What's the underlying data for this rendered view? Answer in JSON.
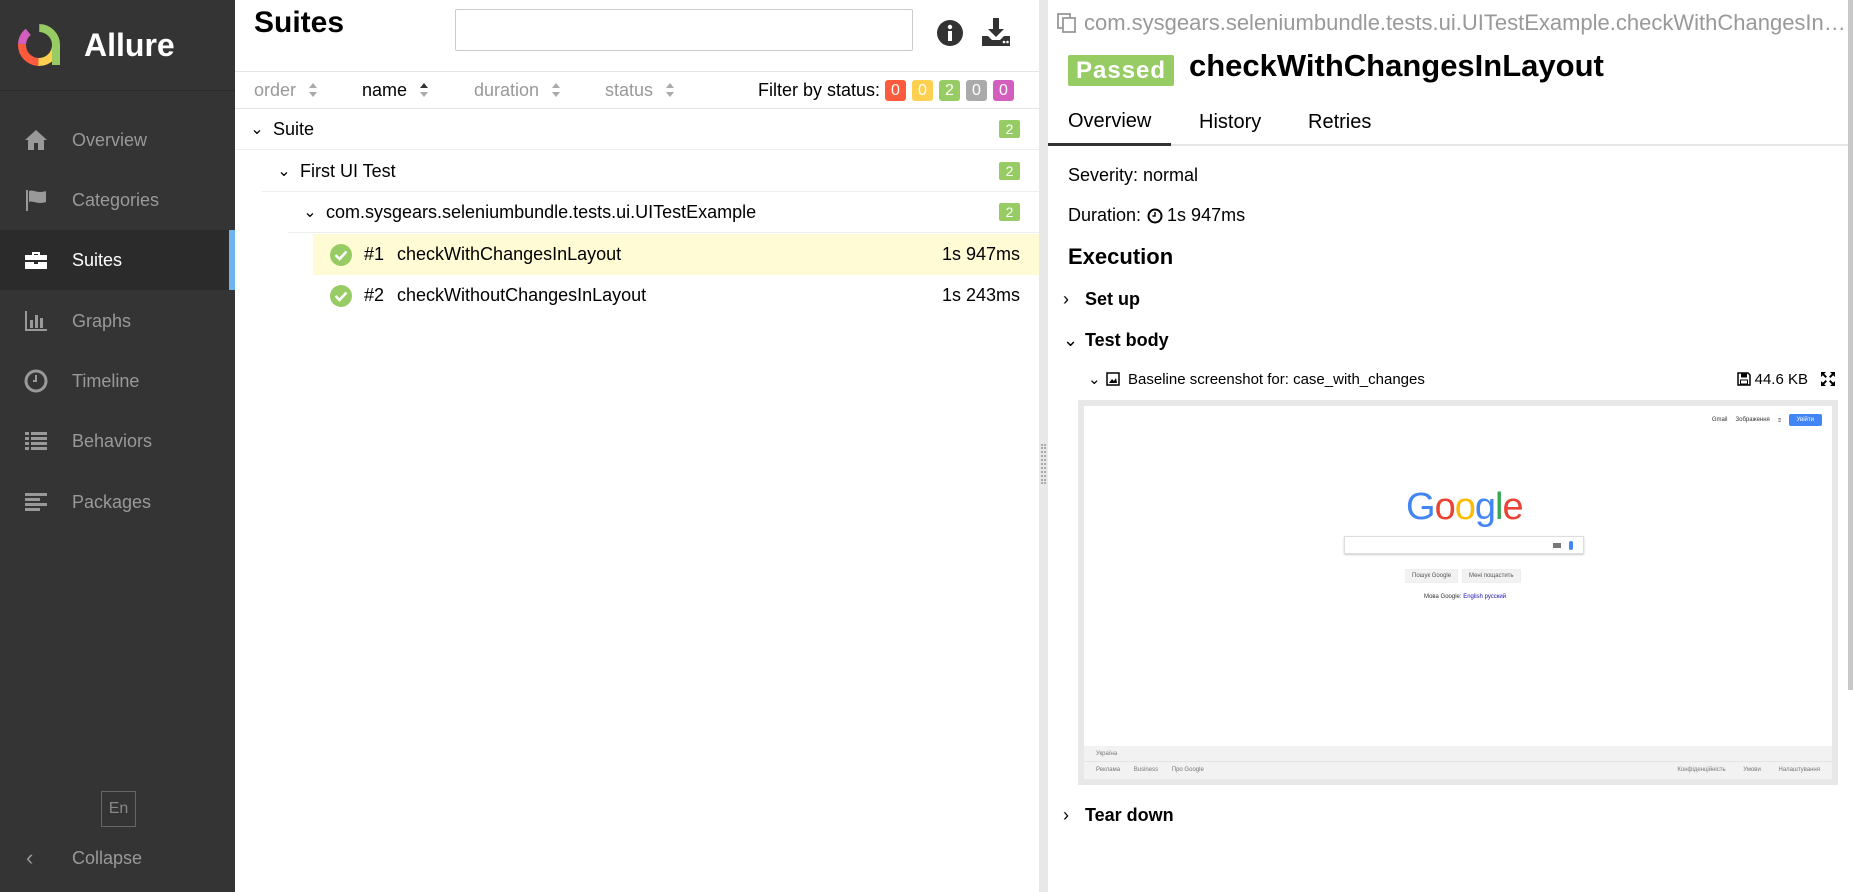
{
  "app": {
    "name": "Allure"
  },
  "sidebar": {
    "items": [
      {
        "label": "Overview",
        "icon": "home-icon"
      },
      {
        "label": "Categories",
        "icon": "flag-icon"
      },
      {
        "label": "Suites",
        "icon": "briefcase-icon",
        "active": true
      },
      {
        "label": "Graphs",
        "icon": "bar-chart-icon"
      },
      {
        "label": "Timeline",
        "icon": "clock-icon"
      },
      {
        "label": "Behaviors",
        "icon": "list-icon"
      },
      {
        "label": "Packages",
        "icon": "align-left-icon"
      }
    ],
    "language": "En",
    "collapse_label": "Collapse"
  },
  "suites": {
    "title": "Suites",
    "search": {
      "value": "",
      "placeholder": ""
    },
    "sort_columns": [
      {
        "label": "order"
      },
      {
        "label": "name",
        "active": true
      },
      {
        "label": "duration"
      },
      {
        "label": "status"
      }
    ],
    "filter_label": "Filter by status:",
    "filter_badges": [
      {
        "value": "0",
        "color": "#fd5a3e"
      },
      {
        "value": "0",
        "color": "#ffd050"
      },
      {
        "value": "2",
        "color": "#97cc64"
      },
      {
        "value": "0",
        "color": "#aaaaaa"
      },
      {
        "value": "0",
        "color": "#d35ebe"
      }
    ],
    "tree": [
      {
        "label": "Suite",
        "count": "2"
      },
      {
        "label": "First UI Test",
        "count": "2"
      },
      {
        "label": "com.sysgears.seleniumbundle.tests.ui.UITestExample",
        "count": "2"
      }
    ],
    "tests": [
      {
        "num": "#1",
        "name": "checkWithChangesInLayout",
        "duration": "1s 947ms",
        "selected": true
      },
      {
        "num": "#2",
        "name": "checkWithoutChangesInLayout",
        "duration": "1s 243ms"
      }
    ]
  },
  "detail": {
    "path": "com.sysgears.seleniumbundle.tests.ui.UITestExample.checkWithChangesInLayout",
    "status": "Passed",
    "title": "checkWithChangesInLayout",
    "tabs": [
      "Overview",
      "History",
      "Retries"
    ],
    "severity": "Severity: normal",
    "duration_label": "Duration:",
    "duration": "1s 947ms",
    "execution_title": "Execution",
    "steps": {
      "setup": "Set up",
      "body": "Test body",
      "teardown": "Tear down"
    },
    "attachment": {
      "name": "Baseline screenshot for: case_with_changes",
      "size": "44.6 KB"
    },
    "preview": {
      "top_links": [
        "Gmail",
        "Зображення"
      ],
      "signin": "Увійти",
      "logo_letters": [
        {
          "char": "G",
          "color": "#4285f4"
        },
        {
          "char": "o",
          "color": "#ea4335"
        },
        {
          "char": "o",
          "color": "#fbbc05"
        },
        {
          "char": "g",
          "color": "#4285f4"
        },
        {
          "char": "l",
          "color": "#34a853"
        },
        {
          "char": "e",
          "color": "#ea4335"
        }
      ],
      "buttons": [
        "Пошук Google",
        "Мені пощастить"
      ],
      "lang_prefix": "Мова Google:",
      "lang_links": "English  русский",
      "country": "Україна",
      "footer_left": [
        "Реклама",
        "Business",
        "Про Google"
      ],
      "footer_right": [
        "Конфіденційність",
        "Умови",
        "Налаштування"
      ]
    }
  }
}
